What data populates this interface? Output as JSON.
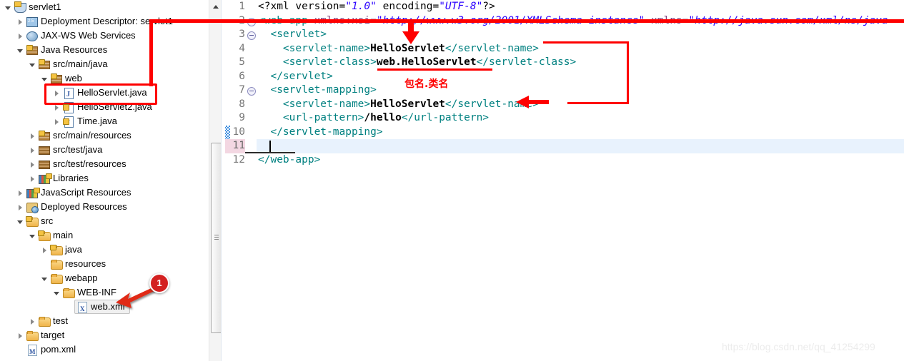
{
  "explorer": {
    "name": "package-explorer",
    "items": [
      {
        "label": "servlet1",
        "icon": "project-icon",
        "indent": 0,
        "twisty": "expanded"
      },
      {
        "label": "Deployment Descriptor: servlet1",
        "icon": "deployment-descriptor-icon",
        "indent": 1,
        "twisty": "collapsed"
      },
      {
        "label": "JAX-WS Web Services",
        "icon": "jax-ws-icon",
        "indent": 1,
        "twisty": "collapsed"
      },
      {
        "label": "Java Resources",
        "icon": "java-resources-icon",
        "indent": 1,
        "twisty": "expanded"
      },
      {
        "label": "src/main/java",
        "icon": "source-folder-icon",
        "indent": 2,
        "twisty": "expanded"
      },
      {
        "label": "web",
        "icon": "package-icon",
        "indent": 3,
        "twisty": "expanded"
      },
      {
        "label": "HelloServlet.java",
        "icon": "java-file-icon",
        "indent": 4,
        "twisty": "collapsed"
      },
      {
        "label": "HelloServlet2.java",
        "icon": "java-file-warning-icon",
        "indent": 4,
        "twisty": "collapsed"
      },
      {
        "label": "Time.java",
        "icon": "java-file-warning-icon",
        "indent": 4,
        "twisty": "collapsed"
      },
      {
        "label": "src/main/resources",
        "icon": "source-folder-icon",
        "indent": 2,
        "twisty": "collapsed"
      },
      {
        "label": "src/test/java",
        "icon": "source-folder-plain-icon",
        "indent": 2,
        "twisty": "collapsed"
      },
      {
        "label": "src/test/resources",
        "icon": "source-folder-plain-icon",
        "indent": 2,
        "twisty": "collapsed"
      },
      {
        "label": "Libraries",
        "icon": "libraries-icon",
        "indent": 2,
        "twisty": "collapsed"
      },
      {
        "label": "JavaScript Resources",
        "icon": "libraries-icon",
        "indent": 1,
        "twisty": "collapsed"
      },
      {
        "label": "Deployed Resources",
        "icon": "deployed-resources-icon",
        "indent": 1,
        "twisty": "collapsed"
      },
      {
        "label": "src",
        "icon": "folder-warning-icon",
        "indent": 1,
        "twisty": "expanded"
      },
      {
        "label": "main",
        "icon": "folder-warning-icon",
        "indent": 2,
        "twisty": "expanded"
      },
      {
        "label": "java",
        "icon": "folder-warning-icon",
        "indent": 3,
        "twisty": "collapsed"
      },
      {
        "label": "resources",
        "icon": "folder-icon",
        "indent": 3,
        "twisty": "none"
      },
      {
        "label": "webapp",
        "icon": "folder-icon",
        "indent": 3,
        "twisty": "expanded"
      },
      {
        "label": "WEB-INF",
        "icon": "folder-icon",
        "indent": 4,
        "twisty": "expanded"
      },
      {
        "label": "web.xml",
        "icon": "xml-file-icon",
        "indent": 5,
        "twisty": "none",
        "selected": true
      },
      {
        "label": "test",
        "icon": "folder-icon",
        "indent": 2,
        "twisty": "collapsed"
      },
      {
        "label": "target",
        "icon": "folder-icon",
        "indent": 1,
        "twisty": "collapsed"
      },
      {
        "label": "pom.xml",
        "icon": "pom-file-icon",
        "indent": 1,
        "twisty": "none"
      }
    ]
  },
  "editor": {
    "name": "xml-editor",
    "lines": [
      {
        "num": "1",
        "fold": false,
        "marker": false,
        "highlight": false,
        "tokens": [
          {
            "t": "p",
            "v": "<?xml version="
          },
          {
            "t": "s",
            "v": "\"1.0\""
          },
          {
            "t": "p",
            "v": " encoding="
          },
          {
            "t": "s",
            "v": "\"UTF-8\""
          },
          {
            "t": "p",
            "v": "?>"
          }
        ]
      },
      {
        "num": "2",
        "fold": true,
        "marker": false,
        "highlight": false,
        "tokens": [
          {
            "t": "t",
            "v": "<web-app "
          },
          {
            "t": "a",
            "v": "xmlns:xsi="
          },
          {
            "t": "s",
            "v": "\"http://www.w3.org/2001/XMLSchema-instance\""
          },
          {
            "t": "p",
            "v": " "
          },
          {
            "t": "a",
            "v": "xmlns="
          },
          {
            "t": "s",
            "v": "\"http://java.sun.com/xml/ns/java"
          }
        ]
      },
      {
        "num": "3",
        "fold": true,
        "marker": false,
        "highlight": false,
        "tokens": [
          {
            "t": "p",
            "v": "  "
          },
          {
            "t": "t",
            "v": "<servlet>"
          }
        ]
      },
      {
        "num": "4",
        "fold": false,
        "marker": false,
        "highlight": false,
        "tokens": [
          {
            "t": "p",
            "v": "    "
          },
          {
            "t": "t",
            "v": "<servlet-name>"
          },
          {
            "t": "k",
            "v": "HelloServlet"
          },
          {
            "t": "t",
            "v": "</servlet-name>"
          }
        ]
      },
      {
        "num": "5",
        "fold": false,
        "marker": false,
        "highlight": false,
        "tokens": [
          {
            "t": "p",
            "v": "    "
          },
          {
            "t": "t",
            "v": "<servlet-class>"
          },
          {
            "t": "k",
            "v": "web.HelloServlet"
          },
          {
            "t": "t",
            "v": "</servlet-class>"
          }
        ]
      },
      {
        "num": "6",
        "fold": false,
        "marker": false,
        "highlight": false,
        "tokens": [
          {
            "t": "p",
            "v": "  "
          },
          {
            "t": "t",
            "v": "</servlet>"
          }
        ]
      },
      {
        "num": "7",
        "fold": true,
        "marker": false,
        "highlight": false,
        "tokens": [
          {
            "t": "p",
            "v": "  "
          },
          {
            "t": "t",
            "v": "<servlet-mapping>"
          }
        ]
      },
      {
        "num": "8",
        "fold": false,
        "marker": false,
        "highlight": false,
        "tokens": [
          {
            "t": "p",
            "v": "    "
          },
          {
            "t": "t",
            "v": "<servlet-name>"
          },
          {
            "t": "k",
            "v": "HelloServlet"
          },
          {
            "t": "t",
            "v": "</servlet-name>"
          }
        ]
      },
      {
        "num": "9",
        "fold": false,
        "marker": false,
        "highlight": false,
        "tokens": [
          {
            "t": "p",
            "v": "    "
          },
          {
            "t": "t",
            "v": "<url-pattern>"
          },
          {
            "t": "k",
            "v": "/hello"
          },
          {
            "t": "t",
            "v": "</url-pattern>"
          }
        ]
      },
      {
        "num": "10",
        "fold": false,
        "marker": true,
        "highlight": false,
        "tokens": [
          {
            "t": "p",
            "v": "  "
          },
          {
            "t": "t",
            "v": "</servlet-mapping>"
          }
        ]
      },
      {
        "num": "11",
        "fold": false,
        "marker": true,
        "highlight": true,
        "tokens": [
          {
            "t": "p",
            "v": ""
          }
        ]
      },
      {
        "num": "12",
        "fold": false,
        "marker": false,
        "highlight": false,
        "tokens": [
          {
            "t": "t",
            "v": "</web-app>"
          }
        ]
      }
    ]
  },
  "annotations": {
    "package_class_note": "包名.类名",
    "step_badge": "1",
    "accent_color": "#fe0000",
    "badge_color": "#d32121"
  },
  "watermark": {
    "text": "https://blog.csdn.net/qq_41254299"
  }
}
